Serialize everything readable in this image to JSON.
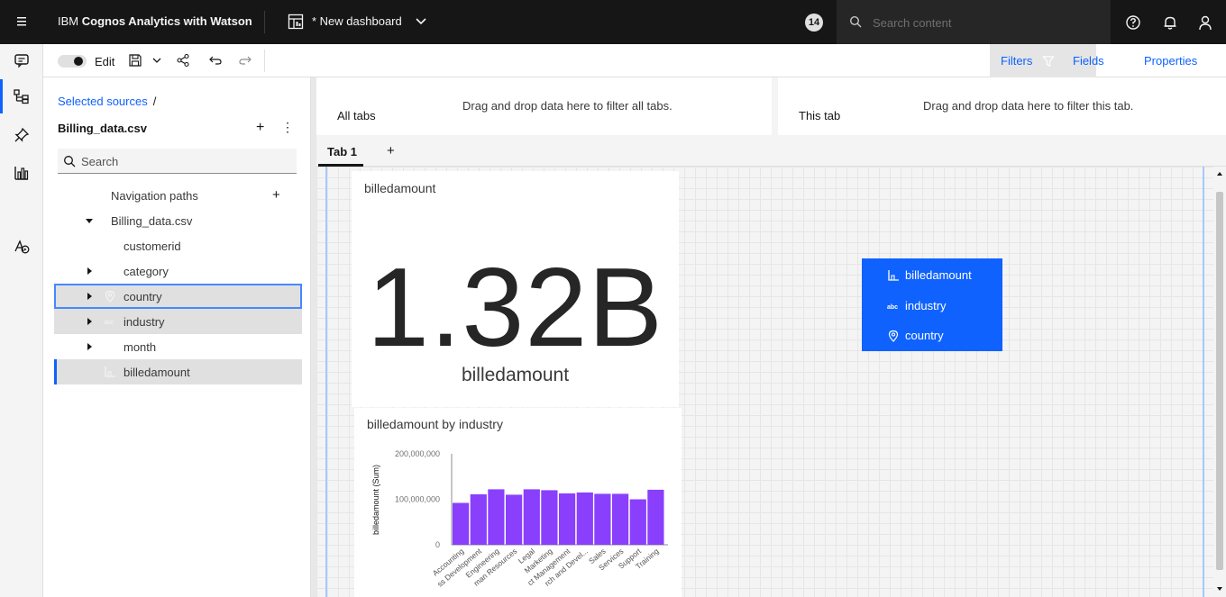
{
  "topbar": {
    "brand_prefix": "IBM ",
    "brand_bold": "Cognos Analytics with Watson",
    "dashboard_title": "* New dashboard",
    "notification_count": "14",
    "search_placeholder": "Search content"
  },
  "toolbar": {
    "edit_label": "Edit",
    "filters_label": "Filters",
    "fields_label": "Fields",
    "properties_label": "Properties"
  },
  "sources": {
    "breadcrumb": "Selected sources",
    "breadcrumb_sep": "/",
    "title": "Billing_data.csv",
    "add": "+",
    "more": "⋮",
    "search_placeholder": "Search",
    "tree": [
      {
        "label": "Navigation paths",
        "icon": "none",
        "caret": "none",
        "state": "normal"
      },
      {
        "label": "Billing_data.csv",
        "icon": "none",
        "caret": "down",
        "state": "normal"
      },
      {
        "label": "customerid",
        "icon": "none",
        "caret": "none",
        "state": "normal"
      },
      {
        "label": "category",
        "icon": "none",
        "caret": "right",
        "state": "normal"
      },
      {
        "label": "country",
        "icon": "location-icon",
        "caret": "right",
        "state": "focused"
      },
      {
        "label": "industry",
        "icon": "abc-icon",
        "caret": "right",
        "state": "selected"
      },
      {
        "label": "month",
        "icon": "none",
        "caret": "right",
        "state": "normal"
      },
      {
        "label": "billedamount",
        "icon": "measure-icon",
        "caret": "none",
        "state": "selected"
      }
    ],
    "nav_add": "+"
  },
  "filters": {
    "all_tabs_label": "All tabs",
    "all_tabs_hint": "Drag and drop data here to filter all tabs.",
    "this_tab_label": "This tab",
    "this_tab_hint": "Drag and drop data here to filter this tab."
  },
  "tabs": {
    "active": "Tab 1",
    "add": "+"
  },
  "kpi": {
    "title": "billedamount",
    "value": "1.32B",
    "label": "billedamount"
  },
  "drop_target": {
    "items": [
      {
        "label": "billedamount",
        "icon": "measure-icon"
      },
      {
        "label": "industry",
        "icon": "abc-icon"
      },
      {
        "label": "country",
        "icon": "location-icon"
      }
    ]
  },
  "chart_data": {
    "type": "bar",
    "title": "billedamount by industry",
    "ylabel": "billedamount (Sum)",
    "xlabel": "",
    "ylim": [
      0,
      200000000
    ],
    "yticks": [
      "200,000,000",
      "100,000,000",
      "0"
    ],
    "categories": [
      "Accounting",
      "Business Development",
      "Engineering",
      "Human Resources",
      "Legal",
      "Marketing",
      "Product Management",
      "Research and Devel...",
      "Sales",
      "Services",
      "Support",
      "Training"
    ],
    "category_labels": [
      "Accounting",
      "ss Development",
      "Engineering",
      "man Resources",
      "Legal",
      "Marketing",
      "ct Management",
      "rch and Devel...",
      "Sales",
      "Services",
      "Support",
      "Training"
    ],
    "values": [
      92000000,
      111000000,
      122000000,
      110000000,
      122000000,
      120000000,
      113000000,
      115000000,
      112000000,
      112000000,
      100000000,
      121000000
    ],
    "bar_color": "#8a3ffc",
    "grid": false
  }
}
